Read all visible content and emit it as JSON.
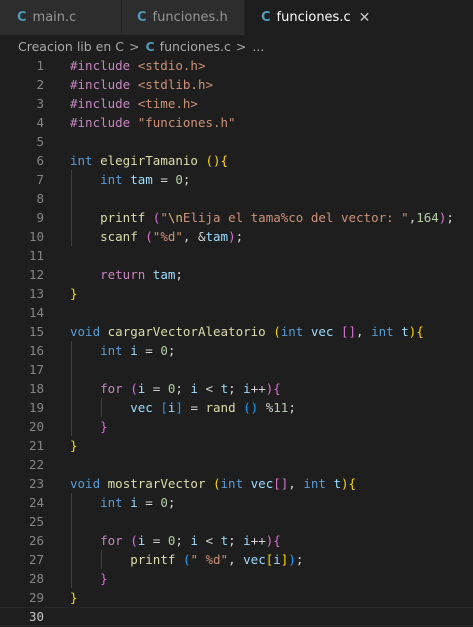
{
  "tabs": [
    {
      "icon": "C",
      "label": "main.c",
      "active": false
    },
    {
      "icon": "C",
      "label": "funciones.h",
      "active": false
    },
    {
      "icon": "C",
      "label": "funciones.c",
      "active": true,
      "close": "✕"
    }
  ],
  "breadcrumb": {
    "folder": "Creacion lib en C",
    "sep": ">",
    "file_icon": "C",
    "file": "funciones.c",
    "more": "..."
  },
  "editor": {
    "active_line": 30,
    "lines": [
      {
        "n": "1",
        "tokens": [
          [
            "pp",
            "#include "
          ],
          [
            "s",
            "<stdio.h>"
          ]
        ]
      },
      {
        "n": "2",
        "tokens": [
          [
            "pp",
            "#include "
          ],
          [
            "s",
            "<stdlib.h>"
          ]
        ]
      },
      {
        "n": "3",
        "tokens": [
          [
            "pp",
            "#include "
          ],
          [
            "s",
            "<time.h>"
          ]
        ]
      },
      {
        "n": "4",
        "tokens": [
          [
            "pp",
            "#include "
          ],
          [
            "s",
            "\"funciones.h\""
          ]
        ]
      },
      {
        "n": "5",
        "tokens": []
      },
      {
        "n": "6",
        "tokens": [
          [
            "k",
            "int "
          ],
          [
            "f",
            "elegirTamanio "
          ],
          [
            "b1",
            "()"
          ],
          [
            "b1",
            "{"
          ]
        ]
      },
      {
        "n": "7",
        "tokens": [
          [
            "p",
            "    "
          ],
          [
            "k",
            "int "
          ],
          [
            "v",
            "tam"
          ],
          [
            "p",
            " = "
          ],
          [
            "n",
            "0"
          ],
          [
            "p",
            ";"
          ]
        ]
      },
      {
        "n": "8",
        "tokens": []
      },
      {
        "n": "9",
        "tokens": [
          [
            "p",
            "    "
          ],
          [
            "f",
            "printf "
          ],
          [
            "b2",
            "("
          ],
          [
            "s",
            "\""
          ],
          [
            "esc",
            "\\n"
          ],
          [
            "s",
            "Elija el tama%co del vector: \""
          ],
          [
            "p",
            ","
          ],
          [
            "n",
            "164"
          ],
          [
            "b2",
            ")"
          ],
          [
            "p",
            ";"
          ]
        ]
      },
      {
        "n": "10",
        "tokens": [
          [
            "p",
            "    "
          ],
          [
            "f",
            "scanf "
          ],
          [
            "b2",
            "("
          ],
          [
            "s",
            "\"%d\""
          ],
          [
            "p",
            ", &"
          ],
          [
            "v",
            "tam"
          ],
          [
            "b2",
            ")"
          ],
          [
            "p",
            ";"
          ]
        ]
      },
      {
        "n": "11",
        "tokens": []
      },
      {
        "n": "12",
        "tokens": [
          [
            "p",
            "    "
          ],
          [
            "pp",
            "return "
          ],
          [
            "v",
            "tam"
          ],
          [
            "p",
            ";"
          ]
        ]
      },
      {
        "n": "13",
        "tokens": [
          [
            "b1",
            "}"
          ]
        ]
      },
      {
        "n": "14",
        "tokens": []
      },
      {
        "n": "15",
        "tokens": [
          [
            "k",
            "void "
          ],
          [
            "f",
            "cargarVectorAleatorio "
          ],
          [
            "b1",
            "("
          ],
          [
            "k",
            "int "
          ],
          [
            "v",
            "vec "
          ],
          [
            "b2",
            "[]"
          ],
          [
            "p",
            ", "
          ],
          [
            "k",
            "int "
          ],
          [
            "v",
            "t"
          ],
          [
            "b1",
            ")"
          ],
          [
            "b1",
            "{"
          ]
        ]
      },
      {
        "n": "16",
        "tokens": [
          [
            "p",
            "    "
          ],
          [
            "k",
            "int "
          ],
          [
            "v",
            "i"
          ],
          [
            "p",
            " = "
          ],
          [
            "n",
            "0"
          ],
          [
            "p",
            ";"
          ]
        ]
      },
      {
        "n": "17",
        "tokens": []
      },
      {
        "n": "18",
        "tokens": [
          [
            "p",
            "    "
          ],
          [
            "pp",
            "for "
          ],
          [
            "b2",
            "("
          ],
          [
            "v",
            "i"
          ],
          [
            "p",
            " = "
          ],
          [
            "n",
            "0"
          ],
          [
            "p",
            "; "
          ],
          [
            "v",
            "i"
          ],
          [
            "p",
            " < "
          ],
          [
            "v",
            "t"
          ],
          [
            "p",
            "; "
          ],
          [
            "v",
            "i"
          ],
          [
            "p",
            "++"
          ],
          [
            "b2",
            ")"
          ],
          [
            "b2",
            "{"
          ]
        ]
      },
      {
        "n": "19",
        "tokens": [
          [
            "p",
            "        "
          ],
          [
            "v",
            "vec "
          ],
          [
            "b3",
            "["
          ],
          [
            "v",
            "i"
          ],
          [
            "b3",
            "]"
          ],
          [
            "p",
            " = "
          ],
          [
            "f",
            "rand "
          ],
          [
            "b3",
            "()"
          ],
          [
            "p",
            " %"
          ],
          [
            "n",
            "11"
          ],
          [
            "p",
            ";"
          ]
        ]
      },
      {
        "n": "20",
        "tokens": [
          [
            "p",
            "    "
          ],
          [
            "b2",
            "}"
          ]
        ]
      },
      {
        "n": "21",
        "tokens": [
          [
            "b1",
            "}"
          ]
        ]
      },
      {
        "n": "22",
        "tokens": []
      },
      {
        "n": "23",
        "tokens": [
          [
            "k",
            "void "
          ],
          [
            "f",
            "mostrarVector "
          ],
          [
            "b1",
            "("
          ],
          [
            "k",
            "int "
          ],
          [
            "v",
            "vec"
          ],
          [
            "b2",
            "[]"
          ],
          [
            "p",
            ", "
          ],
          [
            "k",
            "int "
          ],
          [
            "v",
            "t"
          ],
          [
            "b1",
            ")"
          ],
          [
            "b1",
            "{"
          ]
        ]
      },
      {
        "n": "24",
        "tokens": [
          [
            "p",
            "    "
          ],
          [
            "k",
            "int "
          ],
          [
            "v",
            "i"
          ],
          [
            "p",
            " = "
          ],
          [
            "n",
            "0"
          ],
          [
            "p",
            ";"
          ]
        ]
      },
      {
        "n": "25",
        "tokens": []
      },
      {
        "n": "26",
        "tokens": [
          [
            "p",
            "    "
          ],
          [
            "pp",
            "for "
          ],
          [
            "b2",
            "("
          ],
          [
            "v",
            "i"
          ],
          [
            "p",
            " = "
          ],
          [
            "n",
            "0"
          ],
          [
            "p",
            "; "
          ],
          [
            "v",
            "i"
          ],
          [
            "p",
            " < "
          ],
          [
            "v",
            "t"
          ],
          [
            "p",
            "; "
          ],
          [
            "v",
            "i"
          ],
          [
            "p",
            "++"
          ],
          [
            "b2",
            ")"
          ],
          [
            "b2",
            "{"
          ]
        ]
      },
      {
        "n": "27",
        "tokens": [
          [
            "p",
            "        "
          ],
          [
            "f",
            "printf "
          ],
          [
            "b3",
            "("
          ],
          [
            "s",
            "\" %d\""
          ],
          [
            "p",
            ", "
          ],
          [
            "v",
            "vec"
          ],
          [
            "b1",
            "["
          ],
          [
            "v",
            "i"
          ],
          [
            "b1",
            "]"
          ],
          [
            "b3",
            ")"
          ],
          [
            "p",
            ";"
          ]
        ]
      },
      {
        "n": "28",
        "tokens": [
          [
            "p",
            "    "
          ],
          [
            "b2",
            "}"
          ]
        ]
      },
      {
        "n": "29",
        "tokens": [
          [
            "b1",
            "}"
          ]
        ]
      },
      {
        "n": "30",
        "tokens": []
      }
    ]
  }
}
